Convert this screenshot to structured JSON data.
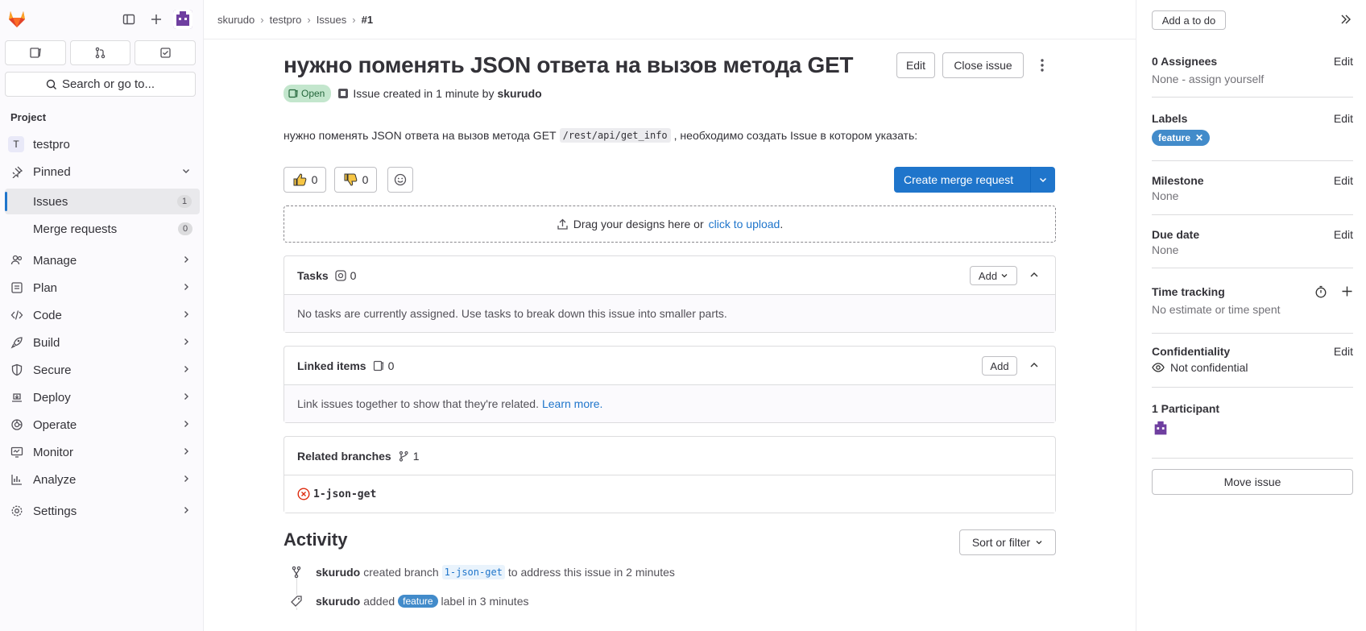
{
  "sidebar": {
    "search_label": "Search or go to...",
    "section_label": "Project",
    "project_letter": "T",
    "project_name": "testpro",
    "pinned_label": "Pinned",
    "issues_label": "Issues",
    "issues_count": "1",
    "mr_label": "Merge requests",
    "mr_count": "0",
    "items": [
      {
        "label": "Manage",
        "icon": "users-icon"
      },
      {
        "label": "Plan",
        "icon": "plan-icon"
      },
      {
        "label": "Code",
        "icon": "code-icon"
      },
      {
        "label": "Build",
        "icon": "rocket-icon"
      },
      {
        "label": "Secure",
        "icon": "shield-icon"
      },
      {
        "label": "Deploy",
        "icon": "deploy-icon"
      },
      {
        "label": "Operate",
        "icon": "operate-icon"
      },
      {
        "label": "Monitor",
        "icon": "monitor-icon"
      },
      {
        "label": "Analyze",
        "icon": "chart-icon"
      },
      {
        "label": "Settings",
        "icon": "gear-icon"
      }
    ]
  },
  "breadcrumb": [
    "skurudo",
    "testpro",
    "Issues",
    "#1"
  ],
  "issue": {
    "title": "нужно поменять JSON ответа на вызов метода GET",
    "edit_label": "Edit",
    "close_label": "Close issue",
    "status": "Open",
    "created_text": "Issue created in 1 minute by",
    "author": "skurudo",
    "desc_pre": "нужно поменять JSON ответа на вызов метода GET",
    "desc_code": "/rest/api/get_info",
    "desc_post": ", необходимо создать Issue в котором указать:",
    "thumbs_up": "0",
    "thumbs_down": "0",
    "create_mr": "Create merge request",
    "drop_text": "Drag your designs here or",
    "drop_link": "click to upload",
    "drop_end": "."
  },
  "tasks": {
    "title": "Tasks",
    "count": "0",
    "add": "Add",
    "empty": "No tasks are currently assigned. Use tasks to break down this issue into smaller parts."
  },
  "linked": {
    "title": "Linked items",
    "count": "0",
    "add": "Add",
    "empty": "Link issues together to show that they're related.",
    "learn": "Learn more."
  },
  "branches": {
    "title": "Related branches",
    "count": "1",
    "branch": "1-json-get"
  },
  "activity": {
    "title": "Activity",
    "sort": "Sort or filter",
    "items": [
      {
        "user": "skurudo",
        "pre": "created branch",
        "code": "1-json-get",
        "post": "to address this issue in 2 minutes"
      },
      {
        "user": "skurudo",
        "pre": "added",
        "tag": "feature",
        "post": "label in 3 minutes"
      }
    ]
  },
  "right": {
    "todo": "Add a to do",
    "assignees_title": "0 Assignees",
    "assignees_val": "None - assign yourself",
    "labels_title": "Labels",
    "label_feature": "feature",
    "milestone_title": "Milestone",
    "milestone_val": "None",
    "due_title": "Due date",
    "due_val": "None",
    "time_title": "Time tracking",
    "time_val": "No estimate or time spent",
    "conf_title": "Confidentiality",
    "conf_val": "Not confidential",
    "participants_title": "1 Participant",
    "move": "Move issue",
    "edit": "Edit"
  }
}
